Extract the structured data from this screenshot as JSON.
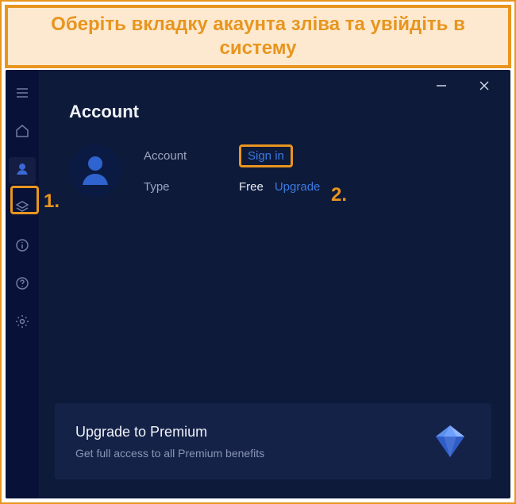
{
  "instruction": "Оберіть вкладку акаунта зліва та увійдіть в систему",
  "callouts": {
    "one": "1.",
    "two": "2."
  },
  "page": {
    "title": "Account",
    "rows": {
      "account_label": "Account",
      "signin": "Sign in",
      "type_label": "Type",
      "type_value": "Free",
      "upgrade": "Upgrade"
    }
  },
  "upgrade_card": {
    "title": "Upgrade to Premium",
    "subtitle": "Get full access to all Premium benefits"
  },
  "sidebar": {
    "items": [
      {
        "name": "menu"
      },
      {
        "name": "home"
      },
      {
        "name": "account",
        "active": true
      },
      {
        "name": "layers"
      },
      {
        "name": "info"
      },
      {
        "name": "help"
      },
      {
        "name": "settings"
      }
    ]
  }
}
